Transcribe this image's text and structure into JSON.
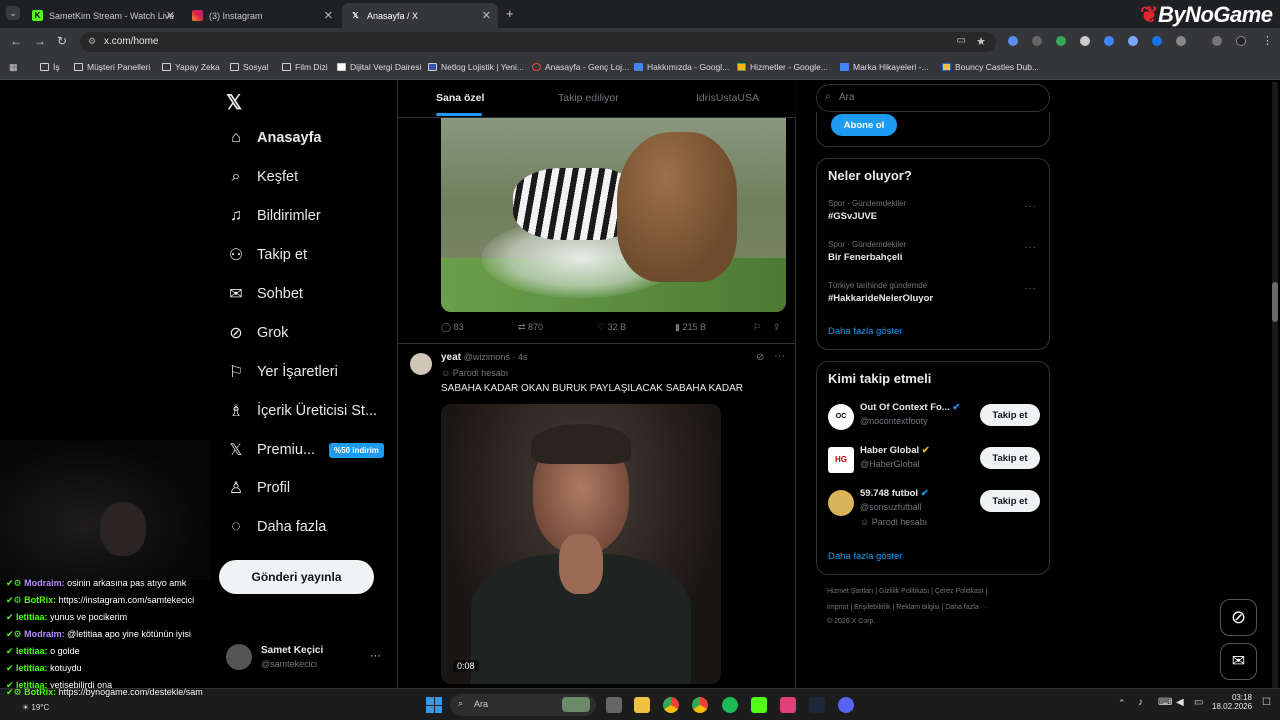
{
  "browser": {
    "tabs": [
      {
        "title": "SametKim Stream - Watch Live"
      },
      {
        "title": "(3) Instagram"
      },
      {
        "title": "Anasayfa / X"
      }
    ],
    "url": "x.com/home",
    "bookmarks": [
      "İş",
      "Müşteri Panelleri",
      "Yapay Zeka",
      "Sosyal",
      "Film Dizi",
      "Dijital Vergi Dairesi",
      "Netlog Lojistik | Yeni...",
      "Anasayfa - Genç Loj...",
      "Hakkımızda - Googl...",
      "Hizmetler - Google...",
      "Marka Hikayeleri -...",
      "Bouncy Castles Dub..."
    ]
  },
  "overlay_logo": "ByNoGame",
  "nav": {
    "items": [
      "Anasayfa",
      "Keşfet",
      "Bildirimler",
      "Takip et",
      "Sohbet",
      "Grok",
      "Yer İşaretleri",
      "İçerik Üreticisi St...",
      "Premiu...",
      "Profil",
      "Daha fazla"
    ],
    "premium_badge": "%50 indirim",
    "post_button": "Gönderi yayınla",
    "account_name": "Samet Keçici",
    "account_handle": "@samtekecici"
  },
  "feed": {
    "tabs": [
      "Sana özel",
      "Takip ediliyor",
      "IdrisUstaUSA"
    ],
    "post1_stats": {
      "replies": "83",
      "reposts": "870",
      "likes": "32 B",
      "views": "215 B"
    },
    "post2": {
      "name": "yeat",
      "handle": "@wizimons · 4s",
      "label": "Parodi hesabı",
      "text": "SABAHA KADAR OKAN BURUK PAYLAŞILACAK SABAHA KADAR",
      "video_time": "0:08"
    }
  },
  "right": {
    "search_placeholder": "Ara",
    "subscribe": "Abone ol",
    "trends_title": "Neler oluyor?",
    "trends": [
      {
        "meta": "Spor · Gündemdekiler",
        "name": "#GSvJUVE"
      },
      {
        "meta": "Spor · Gündemdekiler",
        "name": "Bir Fenerbahçeli"
      },
      {
        "meta": "Türkiye tarihinde gündemde",
        "name": "#HakkarideNelerOluyor"
      }
    ],
    "show_more": "Daha fazla göster",
    "who_title": "Kimi takip etmeli",
    "who": [
      {
        "name": "Out Of Context Fo...",
        "handle": "@nocontextfooty",
        "note": ""
      },
      {
        "name": "Haber Global",
        "handle": "@HaberGlobal",
        "note": ""
      },
      {
        "name": "59.748 futbol",
        "handle": "@sonsuzfutball",
        "note": "Parodi hesabı"
      }
    ],
    "follow": "Takip et",
    "who_more": "Daha fazla göster",
    "footer1": "Hizmet Şartları  |  Gizlilik Politikası  |  Çerez Politikası  |",
    "footer2": "İmprint  |  Erişilebilirlik  |  Reklam bilgisi  |  Daha fazla ···",
    "footer3": "© 2026 X Corp."
  },
  "chat": [
    {
      "user": "Modraim:",
      "msg": "osinin arkasına pas atıyo amk"
    },
    {
      "user": "BotRix:",
      "msg": "https://instagram.com/samtekecici"
    },
    {
      "user": "letitiaa:",
      "msg": "yunus ve pocikerim"
    },
    {
      "user": "Modraim:",
      "msg": "@letitiaa apo yine kötünün iyisi"
    },
    {
      "user": "letitiaa:",
      "msg": "o golde"
    },
    {
      "user": "letitiaa:",
      "msg": "kotuydu"
    },
    {
      "user": "letitiaa:",
      "msg": "yetisebilirdi ona"
    },
    {
      "user": "BotRix:",
      "msg": "https://bynogame.com/destekle/sam"
    }
  ],
  "taskbar": {
    "search": "Ara",
    "weather": "19°C",
    "time": "03:18",
    "date": "18.02.2026"
  }
}
